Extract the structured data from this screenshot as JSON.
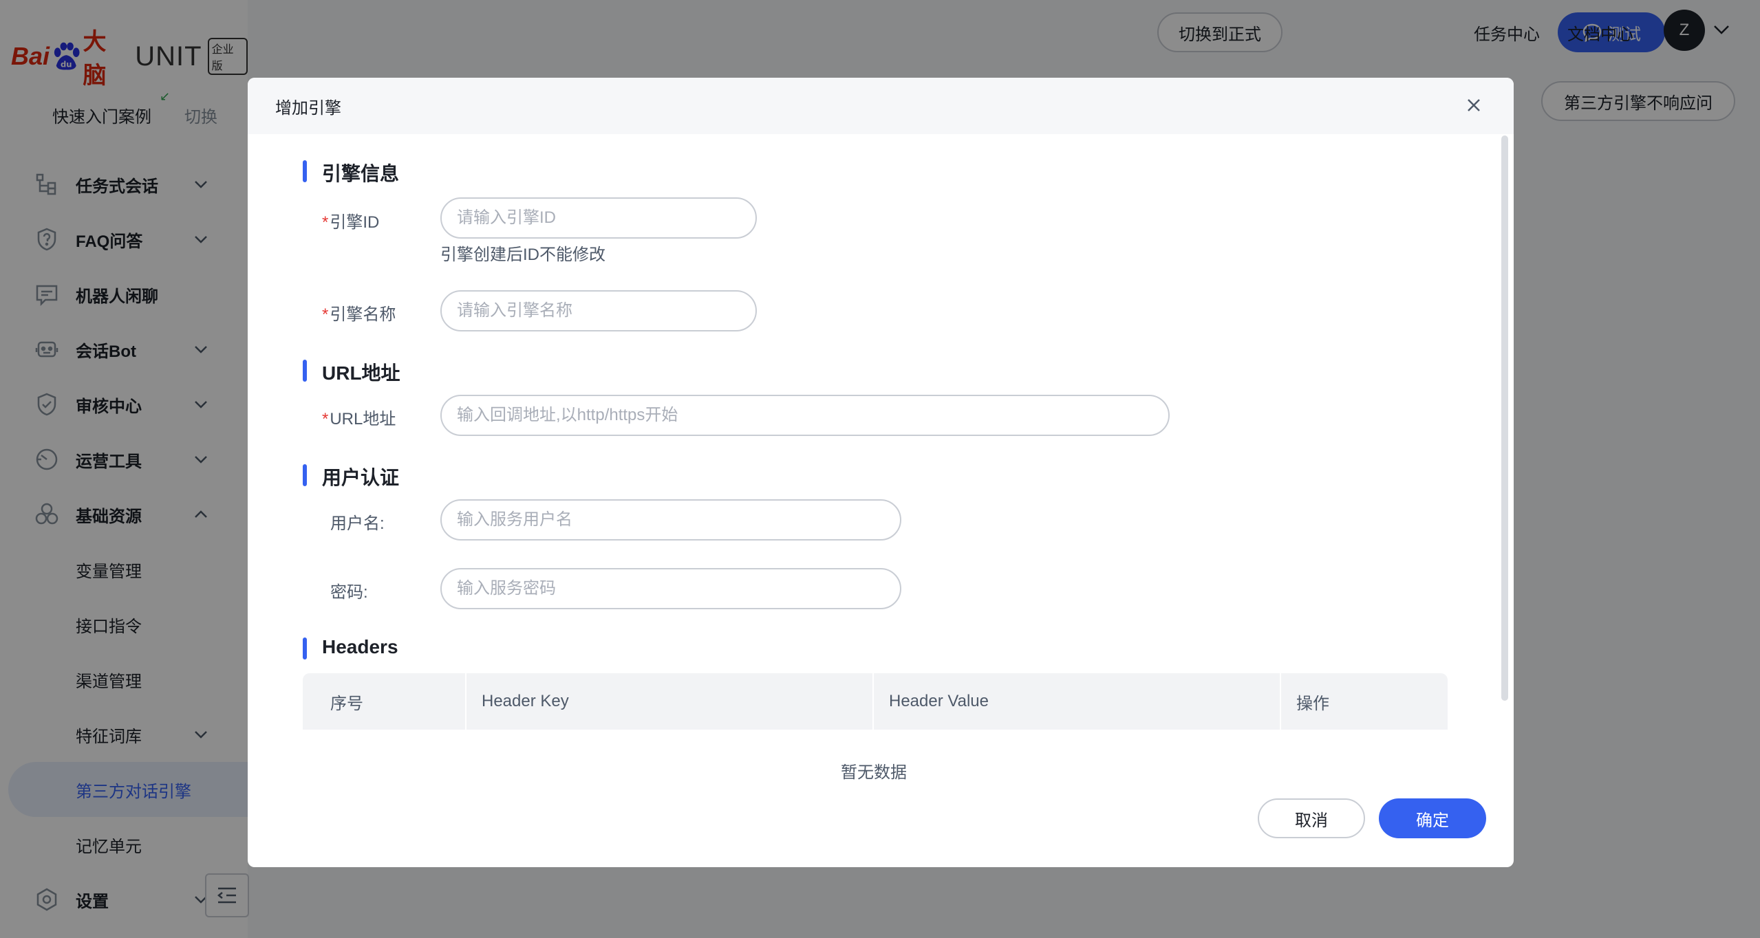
{
  "brand": {
    "logo_text_1": "Bai",
    "logo_text_2": "大脑",
    "product": "UNIT",
    "edition_badge": "企业版",
    "color_red": "#de2910"
  },
  "sidebar": {
    "quick_start": "快速入门案例",
    "switch": "切换",
    "items": [
      {
        "label": "任务式会话",
        "icon": "flow-icon",
        "chevron": "down"
      },
      {
        "label": "FAQ问答",
        "icon": "question-shield-icon",
        "chevron": "down"
      },
      {
        "label": "机器人闲聊",
        "icon": "chat-icon",
        "chevron": ""
      },
      {
        "label": "会话Bot",
        "icon": "bot-icon",
        "chevron": "down"
      },
      {
        "label": "审核中心",
        "icon": "check-shield-icon",
        "chevron": "down"
      },
      {
        "label": "运营工具",
        "icon": "gauge-icon",
        "chevron": "down"
      },
      {
        "label": "基础资源",
        "icon": "cubes-icon",
        "chevron": "up"
      }
    ],
    "sub_items": [
      {
        "label": "变量管理",
        "chevron": ""
      },
      {
        "label": "接口指令",
        "chevron": ""
      },
      {
        "label": "渠道管理",
        "chevron": ""
      },
      {
        "label": "特征词库",
        "chevron": "down"
      },
      {
        "label": "第三方对话引擎",
        "chevron": "",
        "active": true
      },
      {
        "label": "记忆单元",
        "chevron": ""
      }
    ],
    "settings": {
      "label": "设置",
      "icon": "settings-icon"
    }
  },
  "header": {
    "switch_formal": "切换到正式",
    "test": "测试",
    "task_center": "任务中心",
    "doc_center": "文档中心",
    "avatar_letter": "Z",
    "third_party_no_response": "第三方引擎不响应问"
  },
  "modal": {
    "title": "增加引擎",
    "sections": {
      "engine_info": "引擎信息",
      "url": "URL地址",
      "auth": "用户认证",
      "headers": "Headers"
    },
    "fields": {
      "engine_id": {
        "label": "引擎ID",
        "placeholder": "请输入引擎ID",
        "help": "引擎创建后ID不能修改",
        "required": true
      },
      "engine_name": {
        "label": "引擎名称",
        "placeholder": "请输入引擎名称",
        "required": true
      },
      "url": {
        "label": "URL地址",
        "placeholder": "输入回调地址,以http/https开始",
        "required": true
      },
      "username": {
        "label": "用户名:",
        "placeholder": "输入服务用户名"
      },
      "password": {
        "label": "密码:",
        "placeholder": "输入服务密码"
      }
    },
    "table": {
      "columns": [
        "序号",
        "Header Key",
        "Header Value",
        "操作"
      ],
      "empty": "暂无数据"
    },
    "cancel": "取消",
    "confirm": "确定",
    "accent_color": "#3561f0"
  }
}
